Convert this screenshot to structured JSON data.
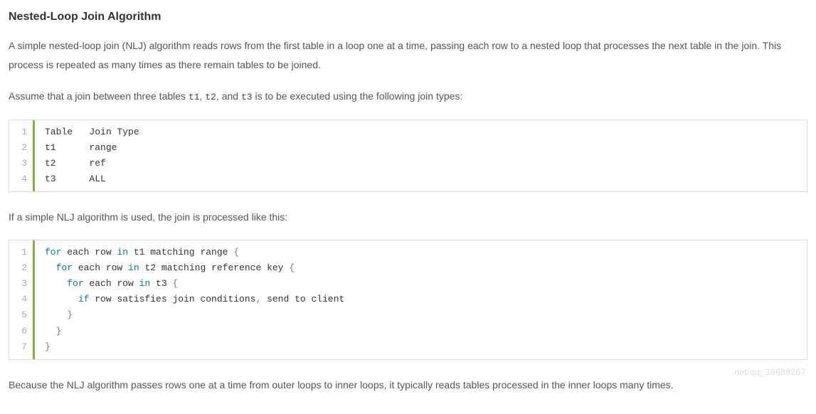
{
  "heading": "Nested-Loop Join Algorithm",
  "para1_a": "A simple nested-loop join (NLJ) algorithm reads rows from the first table in a loop one at a time, passing each row to a nested loop that processes the next table in the join. This process is repeated as many times as there remain tables to be joined.",
  "para2_a": "Assume that a join between three tables ",
  "para2_c1": "t1",
  "para2_b": ", ",
  "para2_c2": "t2",
  "para2_c": ", and ",
  "para2_c3": "t3",
  "para2_d": " is to be executed using the following join types:",
  "code1": {
    "lines": [
      "1",
      "2",
      "3",
      "4"
    ],
    "text": "Table   Join Type\nt1      range\nt2      ref\nt3      ALL"
  },
  "para3": "If a simple NLJ algorithm is used, the join is processed like this:",
  "code2": {
    "lines": [
      "1",
      "2",
      "3",
      "4",
      "5",
      "6",
      "7"
    ],
    "tokens": [
      [
        {
          "t": "for",
          "c": "kw"
        },
        {
          "t": " each row "
        },
        {
          "t": "in",
          "c": "kw"
        },
        {
          "t": " t1 matching range "
        },
        {
          "t": "{",
          "c": "op"
        }
      ],
      [
        {
          "t": "  "
        },
        {
          "t": "for",
          "c": "kw"
        },
        {
          "t": " each row "
        },
        {
          "t": "in",
          "c": "kw"
        },
        {
          "t": " t2 matching reference key "
        },
        {
          "t": "{",
          "c": "op"
        }
      ],
      [
        {
          "t": "    "
        },
        {
          "t": "for",
          "c": "kw"
        },
        {
          "t": " each row "
        },
        {
          "t": "in",
          "c": "kw"
        },
        {
          "t": " t3 "
        },
        {
          "t": "{",
          "c": "op"
        }
      ],
      [
        {
          "t": "      "
        },
        {
          "t": "if",
          "c": "kw"
        },
        {
          "t": " row satisfies join conditions"
        },
        {
          "t": ",",
          "c": "op"
        },
        {
          "t": " send to client"
        }
      ],
      [
        {
          "t": "    "
        },
        {
          "t": "}",
          "c": "op"
        }
      ],
      [
        {
          "t": "  "
        },
        {
          "t": "}",
          "c": "op"
        }
      ],
      [
        {
          "t": "}",
          "c": "op"
        }
      ]
    ]
  },
  "para4": "Because the NLJ algorithm passes rows one at a time from outer loops to inner loops, it typically reads tables processed in the inner loops many times.",
  "watermark": ".net/qq_38688267"
}
